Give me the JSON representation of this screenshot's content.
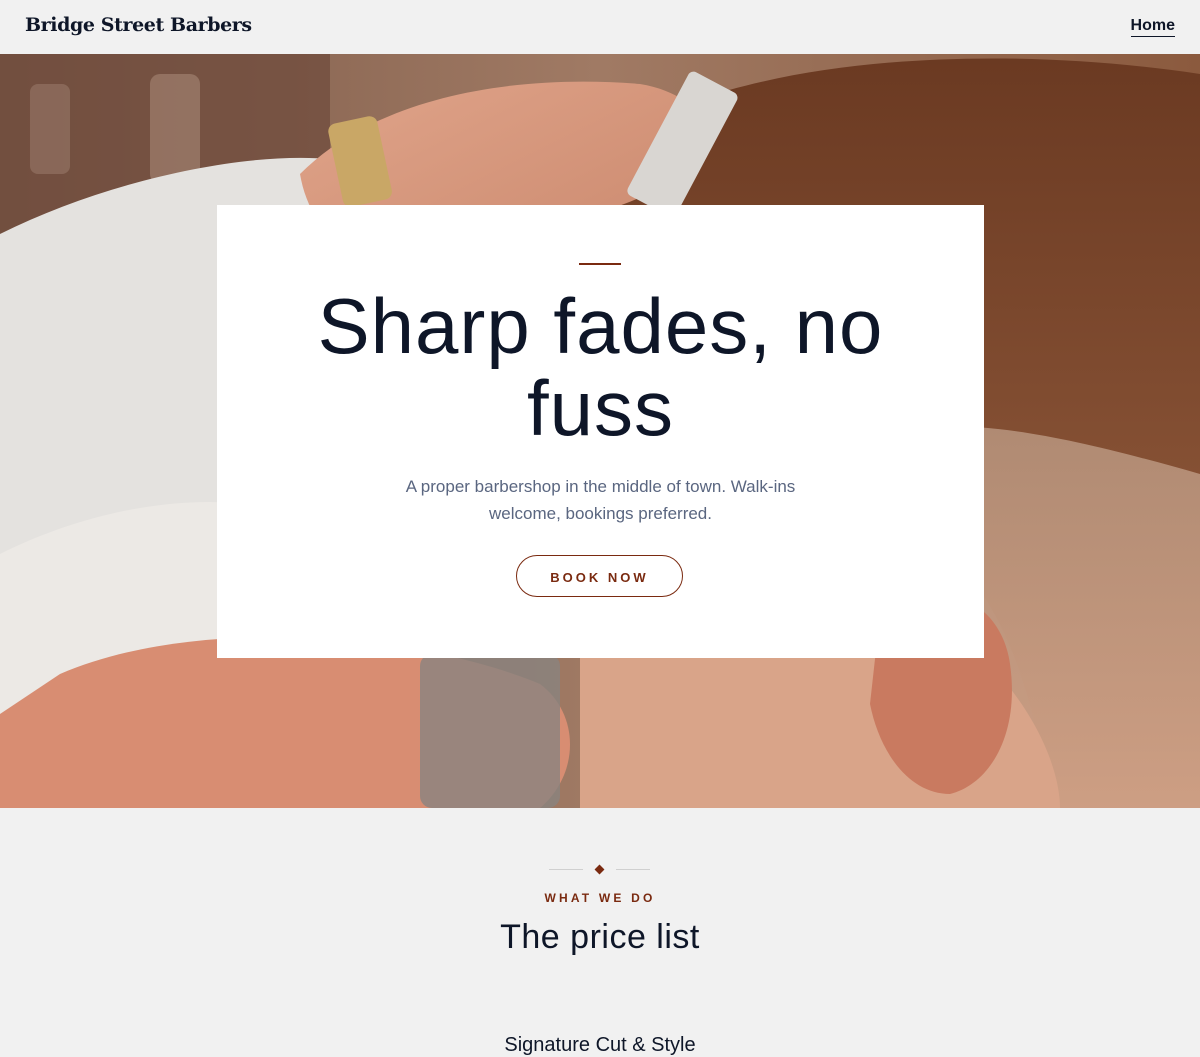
{
  "header": {
    "brand": "Bridge Street Barbers",
    "nav": [
      {
        "label": "Home"
      }
    ]
  },
  "hero": {
    "title": "Sharp fades, no fuss",
    "subtitle": "A proper barbershop in the middle of town. Walk-ins welcome, bookings preferred.",
    "cta_label": "BOOK NOW"
  },
  "price_section": {
    "eyebrow": "WHAT WE DO",
    "title": "The price list",
    "first_service": "Signature Cut & Style"
  },
  "colors": {
    "accent": "#7a2a10",
    "text_dark": "#0e1628",
    "text_muted": "#5a6680",
    "page_background": "#f1f1f1"
  }
}
